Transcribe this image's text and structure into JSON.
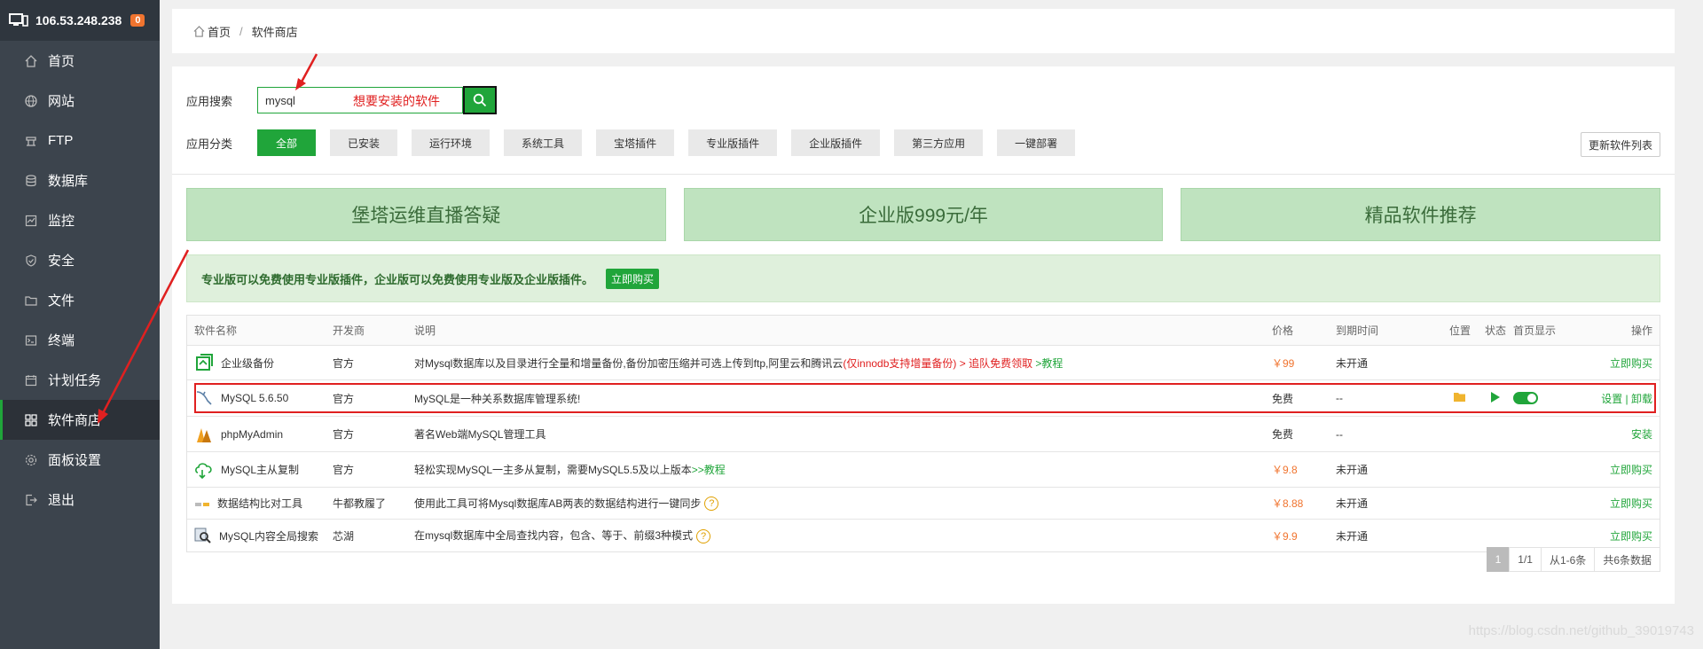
{
  "server": {
    "ip": "106.53.248.238",
    "badge": "0"
  },
  "sidebar": {
    "items": [
      {
        "label": "首页",
        "icon": "home-icon"
      },
      {
        "label": "网站",
        "icon": "globe-icon"
      },
      {
        "label": "FTP",
        "icon": "ftp-icon"
      },
      {
        "label": "数据库",
        "icon": "database-icon"
      },
      {
        "label": "监控",
        "icon": "monitor-icon"
      },
      {
        "label": "安全",
        "icon": "shield-icon"
      },
      {
        "label": "文件",
        "icon": "folder-icon"
      },
      {
        "label": "终端",
        "icon": "terminal-icon"
      },
      {
        "label": "计划任务",
        "icon": "calendar-icon"
      },
      {
        "label": "软件商店",
        "icon": "grid-icon"
      },
      {
        "label": "面板设置",
        "icon": "gear-icon"
      },
      {
        "label": "退出",
        "icon": "logout-icon"
      }
    ]
  },
  "breadcrumb": {
    "home": "首页",
    "sep": "/",
    "current": "软件商店"
  },
  "search": {
    "label": "应用搜索",
    "value": "mysql",
    "annotation": "想要安装的软件"
  },
  "categories": {
    "label": "应用分类",
    "items": [
      "全部",
      "已安装",
      "运行环境",
      "系统工具",
      "宝塔插件",
      "专业版插件",
      "企业版插件",
      "第三方应用",
      "一键部署"
    ],
    "refresh": "更新软件列表"
  },
  "banners": [
    "堡塔运维直播答疑",
    "企业版999元/年",
    "精品软件推荐"
  ],
  "promo": {
    "text": "专业版可以免费使用专业版插件，企业版可以免费使用专业版及企业版插件。",
    "button": "立即购买"
  },
  "table": {
    "headers": {
      "name": "软件名称",
      "dev": "开发商",
      "desc": "说明",
      "price": "价格",
      "expire": "到期时间",
      "pos": "位置",
      "state": "状态",
      "home": "首页显示",
      "op": "操作"
    },
    "rows": [
      {
        "name": "企业级备份",
        "dev": "官方",
        "desc": "对Mysql数据库以及目录进行全量和增量备份,备份加密压缩并可选上传到ftp,阿里云和腾讯云",
        "desc_red": "(仅innodb支持增量备份) > 追队免费领取",
        "desc_link": " >教程",
        "price": "￥99",
        "expire": "未开通",
        "op": "立即购买"
      },
      {
        "name": "MySQL 5.6.50",
        "dev": "官方",
        "desc": "MySQL是一种关系数据库管理系统!",
        "price": "免费",
        "expire": "--",
        "op": "设置 | 卸载"
      },
      {
        "name": "phpMyAdmin",
        "dev": "官方",
        "desc": "著名Web端MySQL管理工具",
        "price": "免费",
        "expire": "--",
        "op": "安装"
      },
      {
        "name": "MySQL主从复制",
        "dev": "官方",
        "desc": "轻松实现MySQL一主多从复制，需要MySQL5.5及以上版本",
        "desc_link": ">>教程",
        "price": "￥9.8",
        "expire": "未开通",
        "op": "立即购买"
      },
      {
        "name": "数据结构比对工具",
        "dev": "牛都教履了",
        "desc": "使用此工具可将Mysql数据库AB两表的数据结构进行一键同步",
        "price": "￥8.88",
        "expire": "未开通",
        "op": "立即购买"
      },
      {
        "name": "MySQL内容全局搜索",
        "dev": "芯湖",
        "desc": "在mysql数据库中全局查找内容，包含、等于、前缀3种模式",
        "price": "￥9.9",
        "expire": "未开通",
        "op": "立即购买"
      }
    ]
  },
  "pager": {
    "current": "1",
    "pages": "1/1",
    "range": "从1-6条",
    "total": "共6条数据"
  },
  "watermark": "https://blog.csdn.net/github_39019743",
  "colors": {
    "accent": "#20a53a",
    "sidebar": "#3c444d",
    "annotation": "#e02020",
    "price": "#f0742f"
  }
}
